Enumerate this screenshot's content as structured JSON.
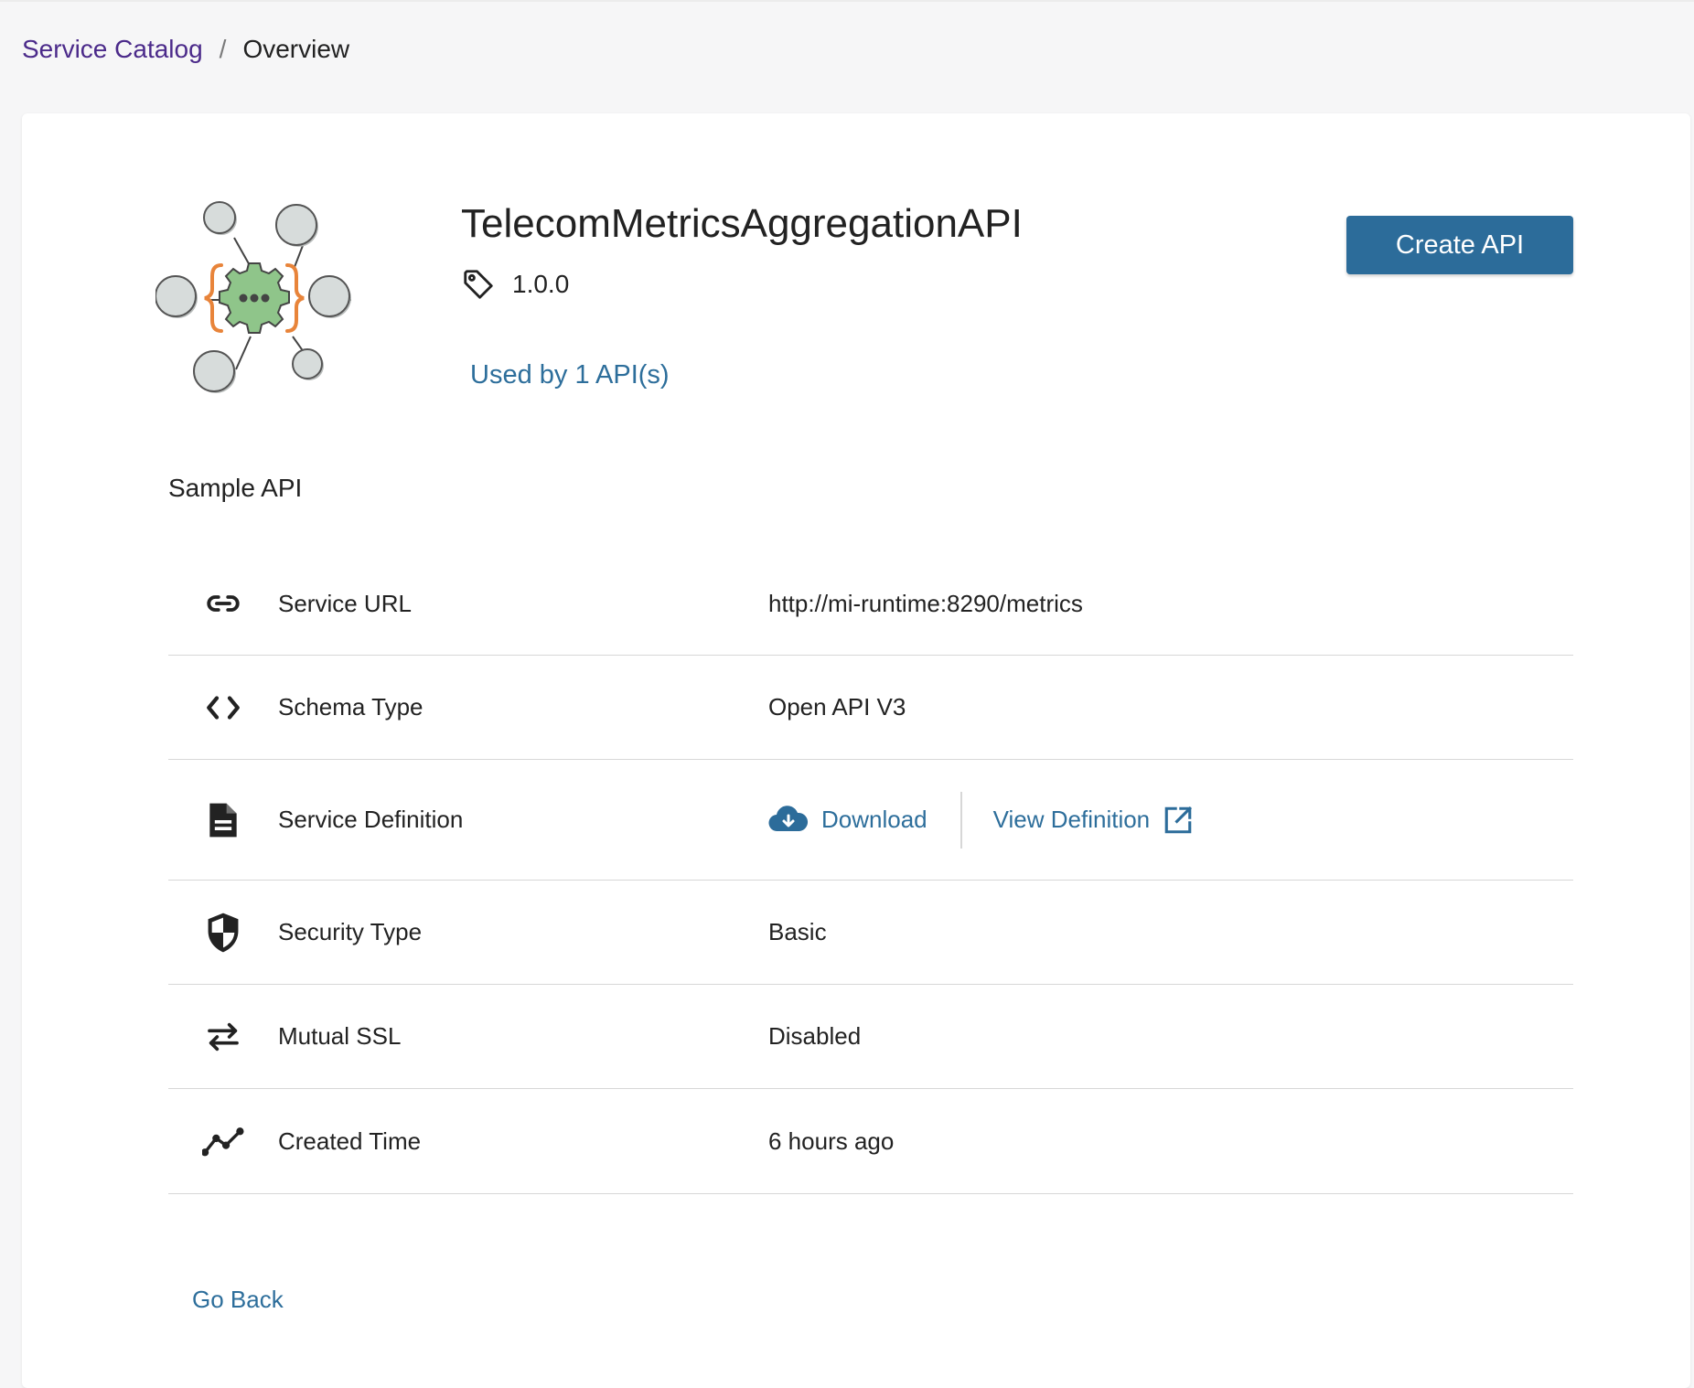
{
  "breadcrumb": {
    "parent": "Service Catalog",
    "separator": "/",
    "current": "Overview"
  },
  "service": {
    "name": "TelecomMetricsAggregationAPI",
    "version": "1.0.0",
    "used_by": "Used by 1 API(s)",
    "description": "Sample API"
  },
  "actions": {
    "create_api": "Create API",
    "go_back": "Go Back"
  },
  "properties": [
    {
      "icon": "link-icon",
      "label": "Service URL",
      "value": "http://mi-runtime:8290/metrics"
    },
    {
      "icon": "code-icon",
      "label": "Schema Type",
      "value": "Open API V3"
    },
    {
      "icon": "document-icon",
      "label": "Service Definition",
      "download": "Download",
      "view": "View Definition"
    },
    {
      "icon": "shield-icon",
      "label": "Security Type",
      "value": "Basic"
    },
    {
      "icon": "swap-arrows-icon",
      "label": "Mutual SSL",
      "value": "Disabled"
    },
    {
      "icon": "trend-line-icon",
      "label": "Created Time",
      "value": "6 hours ago"
    }
  ],
  "colors": {
    "accent": "#2c6c9a",
    "link": "#2d6e9b",
    "breadcrumb_link": "#4b2a8a",
    "logo_gear": "#8fc58a",
    "logo_braces": "#e8843a"
  }
}
